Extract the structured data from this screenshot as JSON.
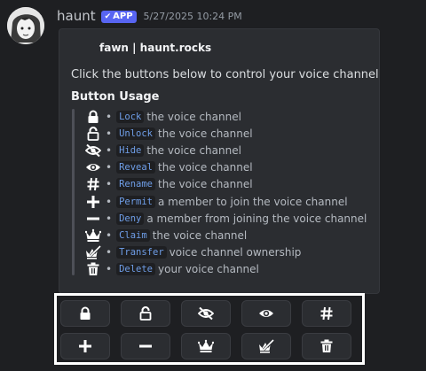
{
  "message": {
    "username": "haunt",
    "app_badge": "APP",
    "timestamp": "5/27/2025 10:24 PM"
  },
  "embed": {
    "author": "fawn | haunt.rocks",
    "description": "Click the buttons below to control your voice channel",
    "subtitle": "Button Usage",
    "items": [
      {
        "icon": "lock-icon",
        "bullet": "•",
        "command": "Lock",
        "text": "the voice channel"
      },
      {
        "icon": "unlock-icon",
        "bullet": "•",
        "command": "Unlock",
        "text": "the voice channel"
      },
      {
        "icon": "eye-slash-icon",
        "bullet": "•",
        "command": "Hide",
        "text": "the voice channel"
      },
      {
        "icon": "eye-icon",
        "bullet": "•",
        "command": "Reveal",
        "text": "the voice channel"
      },
      {
        "icon": "hashtag-icon",
        "bullet": "•",
        "command": "Rename",
        "text": "the voice channel"
      },
      {
        "icon": "plus-icon",
        "bullet": "•",
        "command": "Permit",
        "text": "a member to join the voice channel"
      },
      {
        "icon": "minus-icon",
        "bullet": "•",
        "command": "Deny",
        "text": "a member from joining the voice channel"
      },
      {
        "icon": "crown-icon",
        "bullet": "•",
        "command": "Claim",
        "text": "the voice channel"
      },
      {
        "icon": "transfer-crown-icon",
        "bullet": "•",
        "command": "Transfer",
        "text": "voice channel ownership"
      },
      {
        "icon": "trash-icon",
        "bullet": "•",
        "command": "Delete",
        "text": "your voice channel"
      }
    ]
  },
  "buttons": [
    {
      "icon": "lock-icon"
    },
    {
      "icon": "unlock-icon"
    },
    {
      "icon": "eye-slash-icon"
    },
    {
      "icon": "eye-icon"
    },
    {
      "icon": "hashtag-icon"
    },
    {
      "icon": "plus-icon"
    },
    {
      "icon": "minus-icon"
    },
    {
      "icon": "crown-icon"
    },
    {
      "icon": "transfer-crown-icon"
    },
    {
      "icon": "trash-icon"
    }
  ],
  "colors": {
    "background": "#1e1f22",
    "embed_bg": "#2b2d31",
    "badge": "#5865f2",
    "code_text": "#6f9ee8"
  }
}
